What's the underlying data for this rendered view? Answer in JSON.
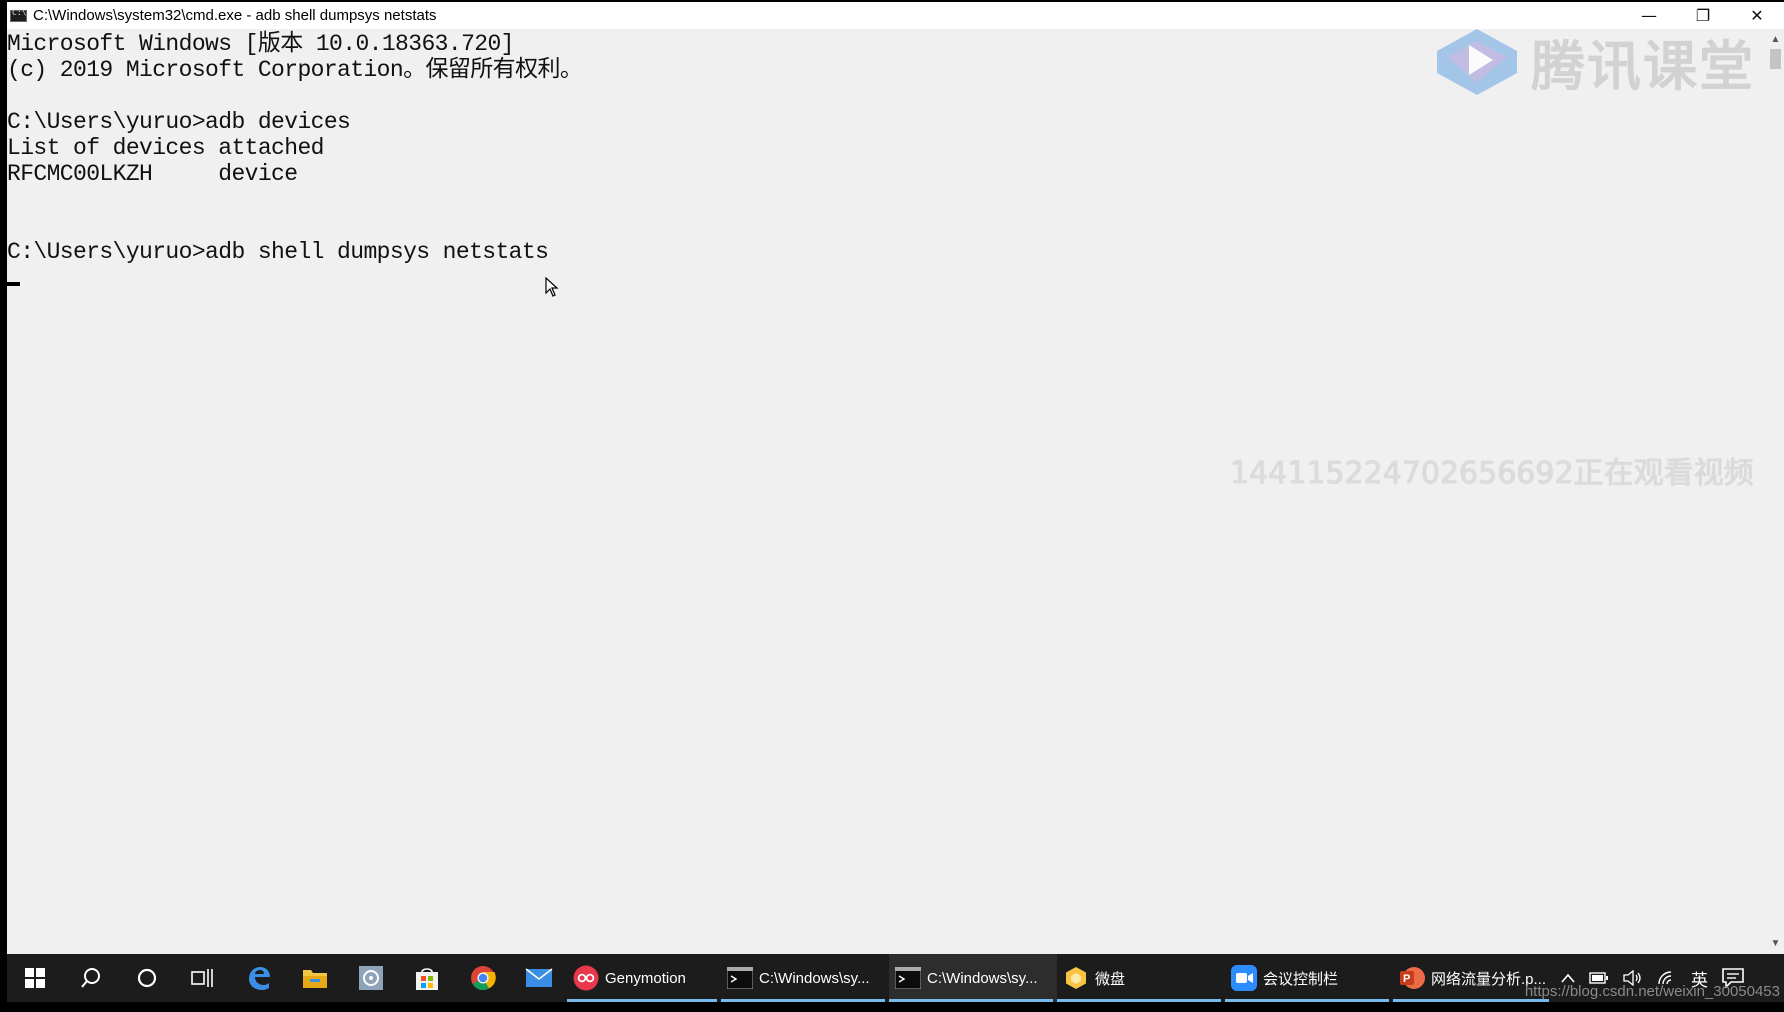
{
  "window": {
    "title": "C:\\Windows\\system32\\cmd.exe - adb  shell dumpsys netstats",
    "controls": {
      "minimize": "—",
      "restore": "❐",
      "close": "✕"
    }
  },
  "console": {
    "lines": [
      "Microsoft Windows [版本 10.0.18363.720]",
      "(c) 2019 Microsoft Corporation。保留所有权利。",
      "",
      "C:\\Users\\yuruo>adb devices",
      "List of devices attached",
      "RFCMC00LKZH     device",
      "",
      "",
      "C:\\Users\\yuruo>adb shell dumpsys netstats"
    ]
  },
  "watermark": {
    "logo_text": "腾讯课堂",
    "viewer_text": "144115224702656692正在观看视频"
  },
  "taskbar": {
    "apps": [
      {
        "label": "Genymotion",
        "icon": "genymotion-icon"
      },
      {
        "label": "C:\\Windows\\sy...",
        "icon": "cmd-icon"
      },
      {
        "label": "C:\\Windows\\sy...",
        "icon": "cmd-icon"
      },
      {
        "label": "微盘",
        "icon": "weipan-icon"
      },
      {
        "label": "会议控制栏",
        "icon": "meeting-icon"
      },
      {
        "label": "网络流量分析.p...",
        "icon": "powerpoint-icon"
      }
    ],
    "tray": {
      "ime": "英",
      "url_watermark": "https://blog.csdn.net/weixin_30050453"
    }
  },
  "colors": {
    "console_bg": "#f0f0f0",
    "taskbar_bg": "#1c1c1c",
    "accent": "#76b9ed"
  }
}
